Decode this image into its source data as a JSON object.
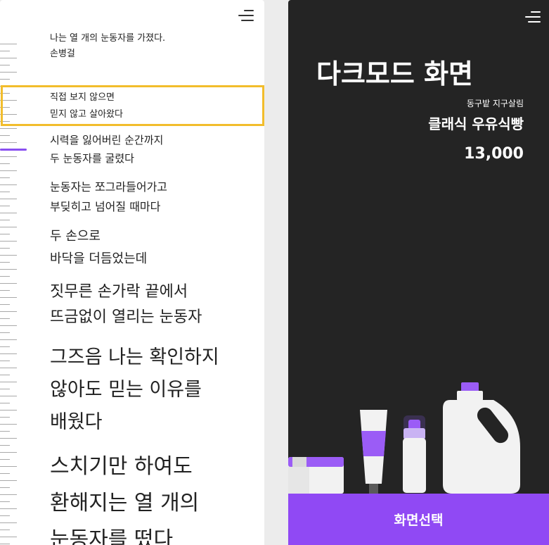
{
  "left_panel": {
    "menu_icon": "hamburger-menu-icon",
    "stanzas": [
      {
        "lines": [
          "나는 열 개의 눈동자를 가졌다.",
          "손병걸"
        ]
      },
      {
        "lines": [
          "직접 보지 않으면",
          "믿지 않고 살아왔다"
        ]
      },
      {
        "lines": [
          "시력을 잃어버린 순간까지",
          "두 눈동자를 굴렸다"
        ]
      },
      {
        "lines": [
          "눈동자는 쪼그라들어가고",
          "부딪히고 넘어질 때마다"
        ]
      },
      {
        "lines": [
          "두 손으로",
          "바닥을 더듬었는데"
        ]
      },
      {
        "lines": [
          "짓무른 손가락 끝에서",
          "뜨금없이 열리는 눈동자"
        ]
      },
      {
        "lines": [
          "그즈음 나는 확인하지",
          "않아도 믿는 이유를",
          "배웠다"
        ]
      },
      {
        "lines": [
          "스치기만 하여도",
          "환해지는 열 개의",
          "눈동자를 떴다"
        ]
      }
    ],
    "highlight_color": "#f2bd2c",
    "scroll_accent": "#8a4ff0"
  },
  "right_panel": {
    "menu_icon": "hamburger-menu-icon",
    "title": "다크모드 화면",
    "brand": "동구밭 지구살림",
    "product": "클래식 우유식빵",
    "price": "13,000",
    "select_button": "화면선택",
    "background": "#242424",
    "accent": "#9049f4"
  }
}
